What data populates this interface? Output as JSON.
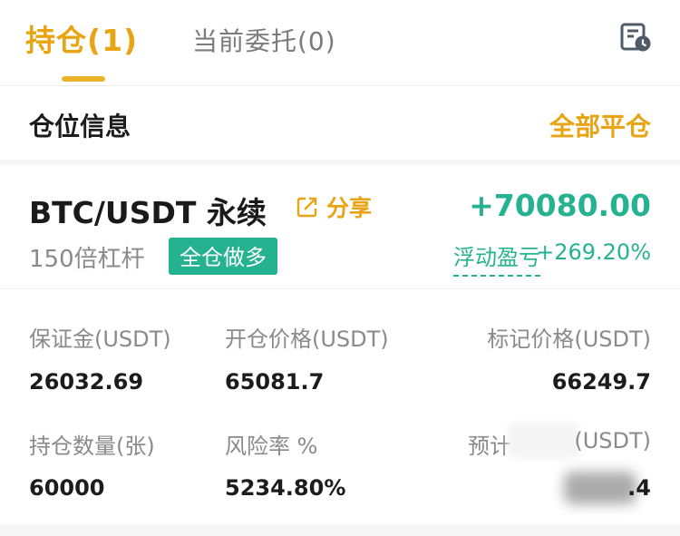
{
  "tabs": {
    "positions_label": "持仓(1)",
    "orders_label": "当前委托(0)"
  },
  "section": {
    "title": "仓位信息",
    "close_all_label": "全部平仓"
  },
  "position": {
    "symbol": "BTC/USDT 永续",
    "share_label": "分享",
    "pnl": "+70080.00",
    "leverage": "150倍杠杆",
    "side_badge": "全仓做多",
    "floating_pnl_label": "浮动盈亏",
    "floating_pnl_pct": "+269.20%"
  },
  "stats": {
    "margin_label": "保证金(USDT)",
    "margin_value": "26032.69",
    "entry_price_label": "开仓价格(USDT)",
    "entry_price_value": "65081.7",
    "mark_price_label": "标记价格(USDT)",
    "mark_price_value": "66249.7",
    "quantity_label": "持仓数量(张)",
    "quantity_value": "60000",
    "risk_label": "风险率 %",
    "risk_value": "5234.80%",
    "liq_label_left": "预计",
    "liq_label_right": "(USDT)",
    "liq_value_suffix": ".4"
  },
  "colors": {
    "accent": "#e9a413",
    "profit": "#25b291",
    "text": "#1c1c1c",
    "muted": "#8a8a8a"
  },
  "icons": {
    "history": "history-clock-icon",
    "share": "share-icon"
  }
}
